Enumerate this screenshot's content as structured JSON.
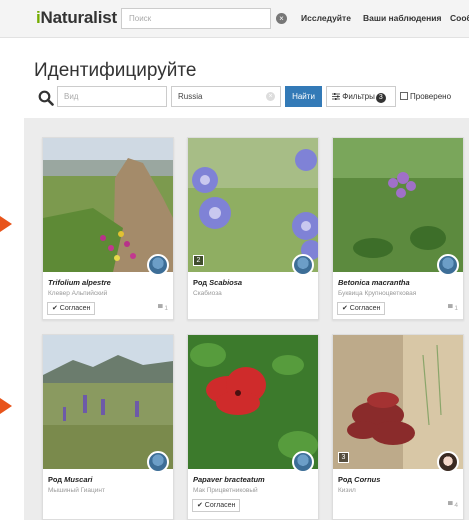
{
  "header": {
    "logo_prefix": "i",
    "logo_rest": "Naturalist",
    "search_placeholder": "Поиск",
    "clear_glyph": "×",
    "nav": [
      "Исследуйте",
      "Ваши наблюдения",
      "Сооб"
    ]
  },
  "page": {
    "title": "Идентифицируйте",
    "species_placeholder": "Вид",
    "place_value": "Russia",
    "place_clear_glyph": "×",
    "find_label": "Найти",
    "filters_label": "Фильтры",
    "filters_count": "3",
    "reviewed_label": "Проверено"
  },
  "observations": [
    {
      "prefix": "",
      "name": "Trifolium alpestre",
      "common": "Клевер Альпийский",
      "agree": "✔ Согласен",
      "comments": "1",
      "photo_count": ""
    },
    {
      "prefix": "Род ",
      "name": "Scabiosa",
      "common": "Скабиоза",
      "agree": "",
      "comments": "",
      "photo_count": "2"
    },
    {
      "prefix": "",
      "name": "Betonica macrantha",
      "common": "Буквица Крупноцветковая",
      "agree": "✔ Согласен",
      "comments": "1",
      "photo_count": ""
    },
    {
      "prefix": "Род ",
      "name": "Muscari",
      "common": "Мышиный Гиацинт",
      "agree": "",
      "comments": "",
      "photo_count": ""
    },
    {
      "prefix": "",
      "name": "Papaver bracteatum",
      "common": "Мак Прицветниковый",
      "agree": "✔ Согласен",
      "comments": "",
      "photo_count": ""
    },
    {
      "prefix": "Род ",
      "name": "Cornus",
      "common": "Кизил",
      "agree": "",
      "comments": "4",
      "photo_count": "3"
    }
  ],
  "colors": {
    "brand_green": "#74ac00",
    "primary_blue": "#337ab7",
    "annotation_arrow": "#e8541b"
  }
}
